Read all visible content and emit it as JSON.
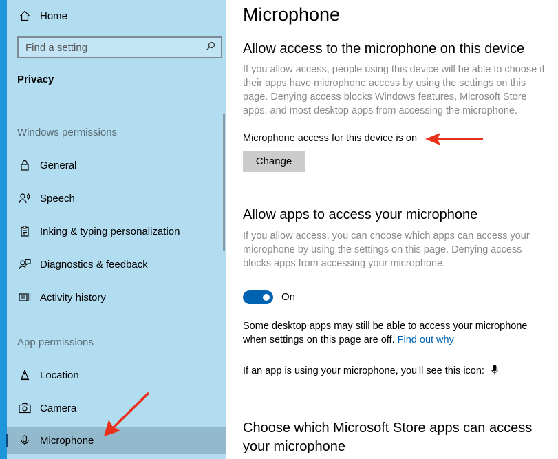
{
  "sidebar": {
    "home_label": "Home",
    "search_placeholder": "Find a setting",
    "section_title": "Privacy",
    "windows_permissions_label": "Windows permissions",
    "windows_items": [
      {
        "label": "General",
        "icon": "lock-icon"
      },
      {
        "label": "Speech",
        "icon": "speech-icon"
      },
      {
        "label": "Inking & typing personalization",
        "icon": "clipboard-icon"
      },
      {
        "label": "Diagnostics & feedback",
        "icon": "feedback-icon"
      },
      {
        "label": "Activity history",
        "icon": "activity-history-icon"
      }
    ],
    "app_permissions_label": "App permissions",
    "app_items": [
      {
        "label": "Location",
        "icon": "location-icon"
      },
      {
        "label": "Camera",
        "icon": "camera-icon"
      },
      {
        "label": "Microphone",
        "icon": "microphone-icon",
        "selected": true
      }
    ]
  },
  "main": {
    "page_title": "Microphone",
    "device_section": {
      "heading": "Allow access to the microphone on this device",
      "description": "If you allow access, people using this device will be able to choose if their apps have microphone access by using the settings on this page. Denying access blocks Windows features, Microsoft Store apps, and most desktop apps from accessing the microphone.",
      "status_text": "Microphone access for this device is on",
      "change_button": "Change"
    },
    "apps_section": {
      "heading": "Allow apps to access your microphone",
      "description": "If you allow access, you can choose which apps can access your microphone by using the settings on this page. Denying access blocks apps from accessing your microphone.",
      "toggle_state": "On",
      "desktop_note": "Some desktop apps may still be able to access your microphone when settings on this page are off.",
      "find_out_link": "Find out why",
      "icon_note": "If an app is using your microphone, you'll see this icon:"
    },
    "store_section": {
      "heading": "Choose which Microsoft Store apps can access your microphone"
    }
  },
  "colors": {
    "sidebar_bg": "#b2dcf0",
    "accent": "#0063b1",
    "annotation_arrow": "#e8311a"
  }
}
